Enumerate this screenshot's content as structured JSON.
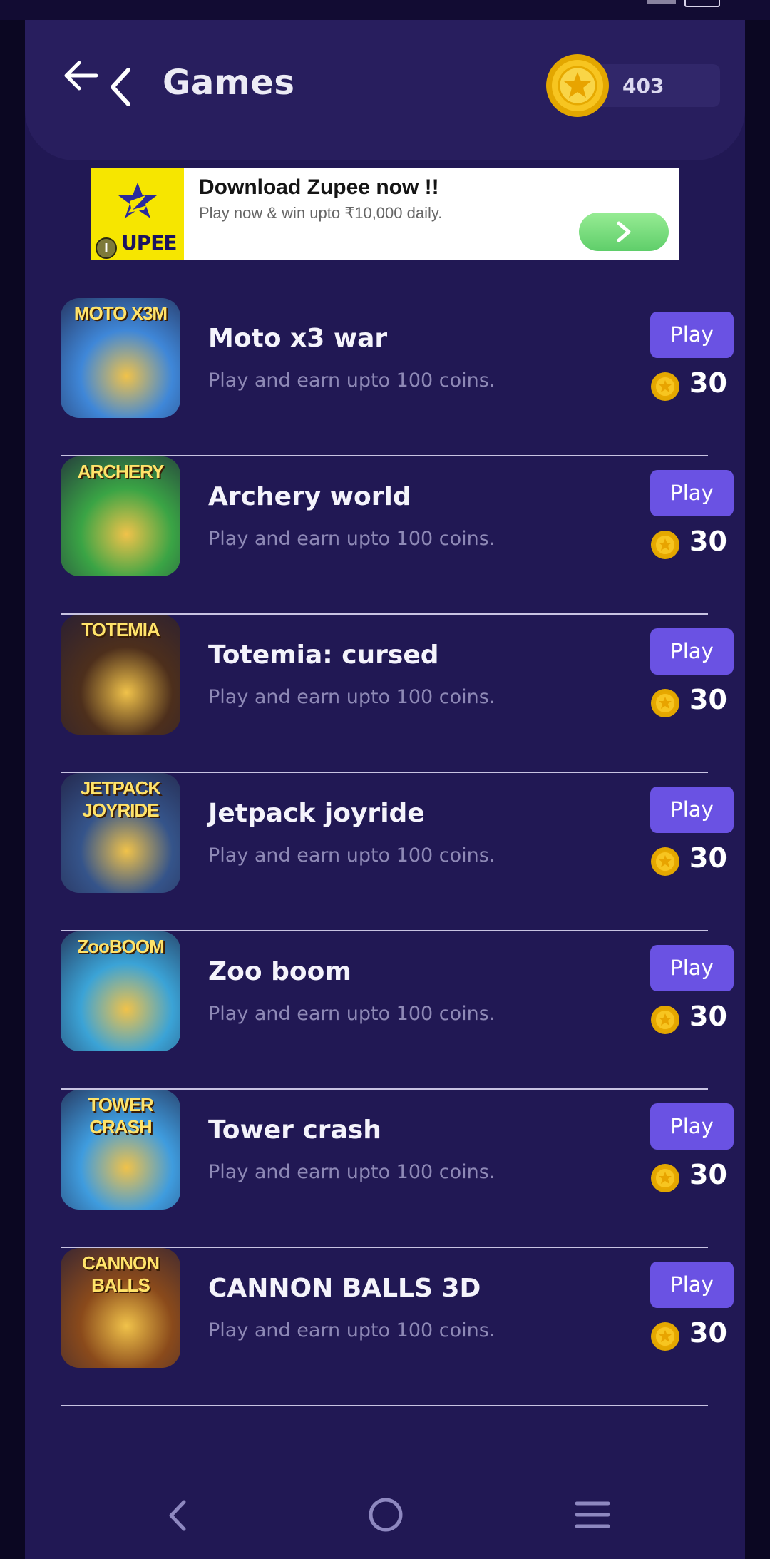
{
  "header": {
    "title": "Games",
    "coin_balance": "403",
    "back_icon": "back-arrow-icon",
    "chevron_icon": "chevron-left-icon"
  },
  "ad": {
    "title": "Download Zupee now !!",
    "subtitle": "Play now & win upto ₹10,000 daily.",
    "logo_text": "UPEE",
    "info_glyph": "i",
    "go_icon": "chevron-right-icon"
  },
  "games": [
    {
      "name": "Moto x3 war",
      "description": "Play and earn upto 100 coins.",
      "play_label": "Play",
      "reward": "30",
      "thumb_label": "MOTO X3M",
      "thumb_color": "#3f87d8"
    },
    {
      "name": "Archery world",
      "description": "Play and earn upto 100 coins.",
      "play_label": "Play",
      "reward": "30",
      "thumb_label": "ARCHERY",
      "thumb_color": "#3aa445"
    },
    {
      "name": "Totemia: cursed",
      "description": "Play and earn upto 100 coins.",
      "play_label": "Play",
      "reward": "30",
      "thumb_label": "TOTEMIA",
      "thumb_color": "#4d2f1c"
    },
    {
      "name": "Jetpack joyride",
      "description": "Play and earn upto 100 coins.",
      "play_label": "Play",
      "reward": "30",
      "thumb_label": "JETPACK JOYRIDE",
      "thumb_color": "#35548a"
    },
    {
      "name": "Zoo boom",
      "description": "Play and earn upto 100 coins.",
      "play_label": "Play",
      "reward": "30",
      "thumb_label": "ZooBOOM",
      "thumb_color": "#3ba3d6"
    },
    {
      "name": "Tower crash",
      "description": "Play and earn upto 100 coins.",
      "play_label": "Play",
      "reward": "30",
      "thumb_label": "TOWER CRASH",
      "thumb_color": "#3f9cde"
    },
    {
      "name": "CANNON BALLS 3D",
      "description": "Play and earn upto 100 coins.",
      "play_label": "Play",
      "reward": "30",
      "thumb_label": "CANNON BALLS",
      "thumb_color": "#8a4a1b"
    }
  ],
  "navbar": {
    "back_icon": "nav-back-icon",
    "home_icon": "nav-home-icon",
    "menu_icon": "nav-menu-icon"
  },
  "colors": {
    "background": "#211854",
    "header": "#281e5e",
    "play_button": "#6a52e3",
    "coin": "#f2b300",
    "description": "#8e89b6"
  }
}
